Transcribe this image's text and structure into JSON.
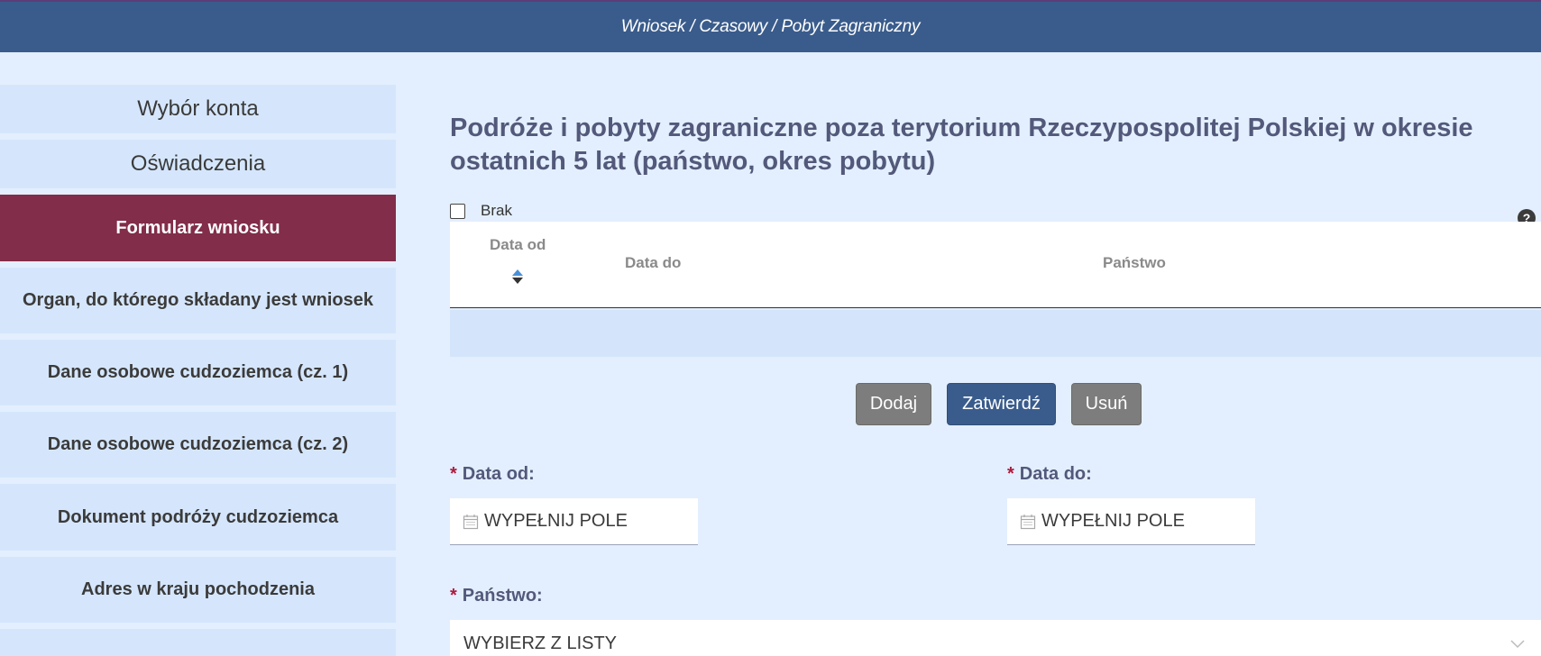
{
  "breadcrumb": "Wniosek / Czasowy / Pobyt Zagraniczny",
  "sidebar": {
    "items": [
      {
        "label": "Wybór konta"
      },
      {
        "label": "Oświadczenia"
      },
      {
        "label": "Formularz wniosku"
      },
      {
        "label": "Organ, do którego składany jest wniosek"
      },
      {
        "label": "Dane osobowe cudzoziemca (cz. 1)"
      },
      {
        "label": "Dane osobowe cudzoziemca (cz. 2)"
      },
      {
        "label": "Dokument podróży cudzoziemca"
      },
      {
        "label": "Adres w kraju pochodzenia"
      },
      {
        "label": ""
      }
    ]
  },
  "main": {
    "heading": "Podróże i pobyty zagraniczne poza terytorium Rzeczypospolitej Polskiej w okresie ostatnich 5 lat (państwo, okres pobytu)",
    "brak_label": "Brak",
    "help_icon": "?",
    "table": {
      "columns": [
        "Data od",
        "Data do",
        "Państwo"
      ]
    },
    "buttons": {
      "add": "Dodaj",
      "confirm": "Zatwierdź",
      "delete": "Usuń"
    },
    "fields": {
      "date_from_label": "Data od:",
      "date_from_value": "WYPEŁNIJ POLE",
      "date_to_label": "Data do:",
      "date_to_value": "WYPEŁNIJ POLE",
      "country_label": "Państwo:",
      "country_value": "WYBIERZ Z LISTY",
      "required_mark": "*"
    }
  },
  "colors": {
    "header": "#3a5c8c",
    "active_nav": "#822d4a",
    "page_bg": "#e3effe",
    "nav_bg": "#d5e6fc",
    "required": "#b0193c"
  },
  "icons": [
    "calendar-icon",
    "sort-icon",
    "help-icon",
    "chevron-down-icon"
  ]
}
